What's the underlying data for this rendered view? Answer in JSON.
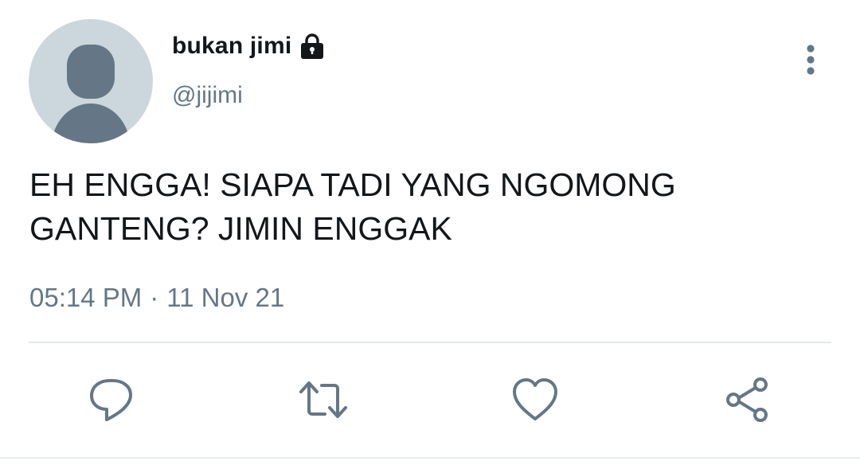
{
  "user": {
    "display_name": "bukan jimi",
    "handle": "@jijimi",
    "protected_icon": "lock-icon",
    "avatar": "default-avatar"
  },
  "tweet": {
    "text": "EH ENGGA! SIAPA TADI YANG NGOMONG\nGANTENG? JIMIN ENGGAK",
    "time": "05:14 PM",
    "separator": "·",
    "date": "11 Nov 21"
  },
  "actions": {
    "reply_icon": "speech-bubble-icon",
    "retweet_icon": "retweet-icon",
    "like_icon": "heart-icon",
    "share_icon": "share-icon",
    "more_icon": "vertical-ellipsis-icon"
  },
  "colors": {
    "text_primary": "#14171a",
    "text_secondary": "#657786",
    "avatar_bg": "#ccd6dd",
    "avatar_figure": "#657786",
    "divider": "#e1e8ed"
  }
}
